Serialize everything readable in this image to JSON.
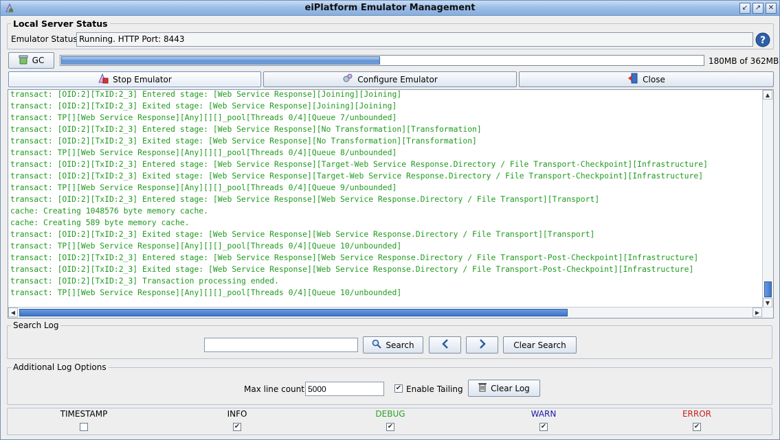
{
  "window": {
    "title": "eiPlatform Emulator Management"
  },
  "server_status": {
    "legend": "Local Server Status",
    "status_label": "Emulator Status:",
    "status_value": "Running. HTTP Port: 8443"
  },
  "memory": {
    "gc_label": "GC",
    "usage_text": "180MB of 362MB",
    "used_fraction": 0.497
  },
  "toolbar": {
    "stop_label": "Stop Emulator",
    "configure_label": "Configure Emulator",
    "close_label": "Close"
  },
  "log": {
    "lines": [
      "transact: [OID:2][TxID:2_3] Entered stage: [Web Service Response][Joining][Joining]",
      "transact: [OID:2][TxID:2_3] Exited stage: [Web Service Response][Joining][Joining]",
      "transact: TP[][Web Service Response][Any][][]_pool[Threads 0/4][Queue 7/unbounded]",
      "transact: [OID:2][TxID:2_3] Entered stage: [Web Service Response][No Transformation][Transformation]",
      "transact: [OID:2][TxID:2_3] Exited stage: [Web Service Response][No Transformation][Transformation]",
      "transact: TP[][Web Service Response][Any][][]_pool[Threads 0/4][Queue 8/unbounded]",
      "transact: [OID:2][TxID:2_3] Entered stage: [Web Service Response][Target-Web Service Response.Directory / File Transport-Checkpoint][Infrastructure]",
      "transact: [OID:2][TxID:2_3] Exited stage: [Web Service Response][Target-Web Service Response.Directory / File Transport-Checkpoint][Infrastructure]",
      "transact: TP[][Web Service Response][Any][][]_pool[Threads 0/4][Queue 9/unbounded]",
      "transact: [OID:2][TxID:2_3] Entered stage: [Web Service Response][Web Service Response.Directory / File Transport][Transport]",
      "cache: Creating 1048576 byte memory cache.",
      "cache: Creating 589 byte memory cache.",
      "transact: [OID:2][TxID:2_3] Exited stage: [Web Service Response][Web Service Response.Directory / File Transport][Transport]",
      "transact: TP[][Web Service Response][Any][][]_pool[Threads 0/4][Queue 10/unbounded]",
      "transact: [OID:2][TxID:2_3] Entered stage: [Web Service Response][Web Service Response.Directory / File Transport-Post-Checkpoint][Infrastructure]",
      "transact: [OID:2][TxID:2_3] Exited stage: [Web Service Response][Web Service Response.Directory / File Transport-Post-Checkpoint][Infrastructure]",
      "transact: [OID:2][TxID:2_3] Transaction processing ended.",
      "transact: TP[][Web Service Response][Any][][]_pool[Threads 0/4][Queue 10/unbounded]"
    ],
    "text_color": "#1e9a1e"
  },
  "search": {
    "legend": "Search Log",
    "input_value": "",
    "search_label": "Search",
    "clear_label": "Clear Search"
  },
  "options": {
    "legend": "Additional Log Options",
    "max_line_label": "Max line count:",
    "max_line_value": "5000",
    "tailing_label": "Enable Tailing",
    "tailing_checked": true,
    "clear_log_label": "Clear Log"
  },
  "levels": [
    {
      "label": "TIMESTAMP",
      "checked": false,
      "color": "#000000"
    },
    {
      "label": "INFO",
      "checked": true,
      "color": "#000000"
    },
    {
      "label": "DEBUG",
      "checked": true,
      "color": "#2aa02a"
    },
    {
      "label": "WARN",
      "checked": true,
      "color": "#1a1aa8"
    },
    {
      "label": "ERROR",
      "checked": true,
      "color": "#c81e1e"
    }
  ]
}
